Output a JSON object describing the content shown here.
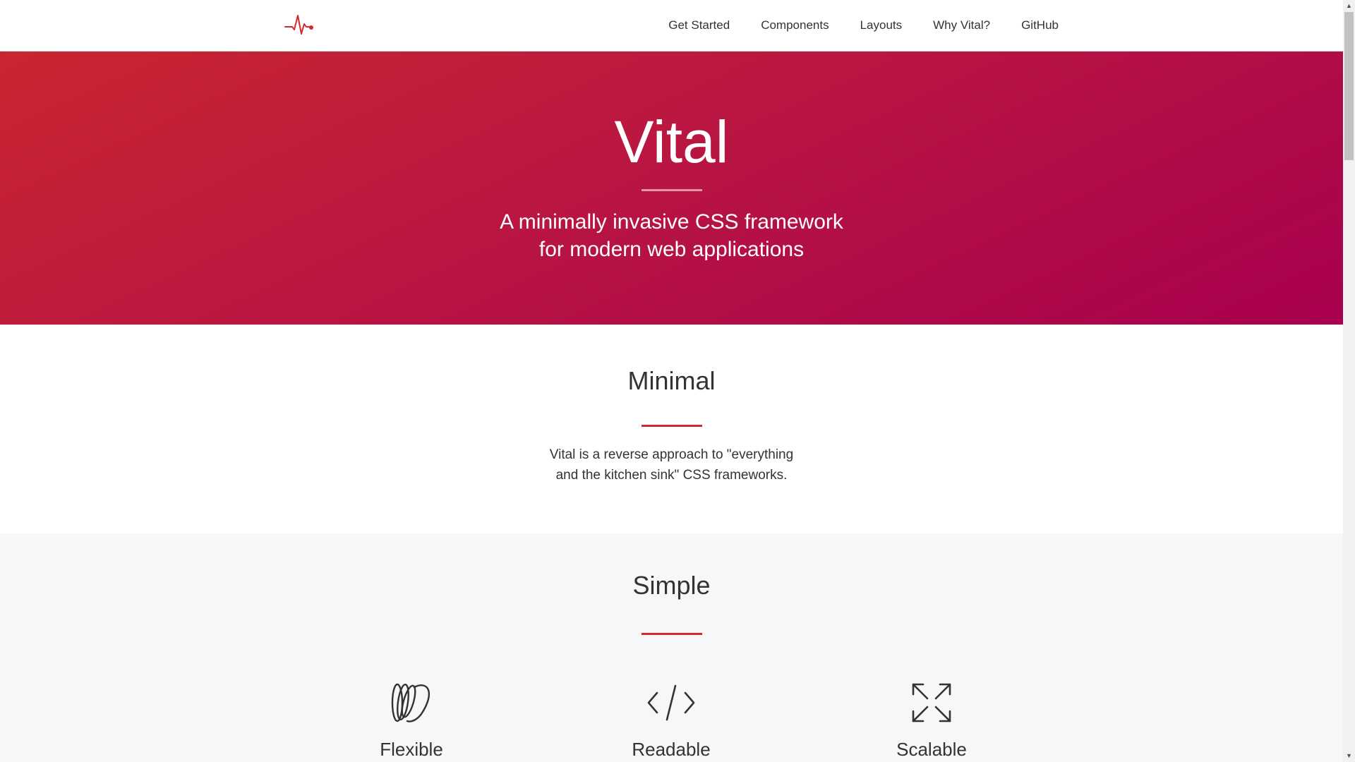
{
  "nav": {
    "logo": "vital-pulse-logo",
    "items": [
      {
        "label": "Get Started"
      },
      {
        "label": "Components"
      },
      {
        "label": "Layouts"
      },
      {
        "label": "Why Vital?"
      },
      {
        "label": "GitHub"
      }
    ]
  },
  "hero": {
    "title": "Vital",
    "subtitle_line1": "A minimally invasive CSS framework",
    "subtitle_line2": "for modern web applications",
    "gradient_start": "#c8262f",
    "gradient_end": "#a8004e"
  },
  "minimal": {
    "title": "Minimal",
    "text_line1": "Vital is a reverse approach to \"everything",
    "text_line2": "and the kitchen sink\" CSS frameworks."
  },
  "simple": {
    "title": "Simple",
    "features": [
      {
        "label": "Flexible",
        "icon": "flexible-coil-icon"
      },
      {
        "label": "Readable",
        "icon": "code-icon"
      },
      {
        "label": "Scalable",
        "icon": "expand-arrows-icon"
      }
    ]
  },
  "colors": {
    "accent": "#d22b2f",
    "text": "#333333",
    "section_bg": "#f7f7f7"
  }
}
